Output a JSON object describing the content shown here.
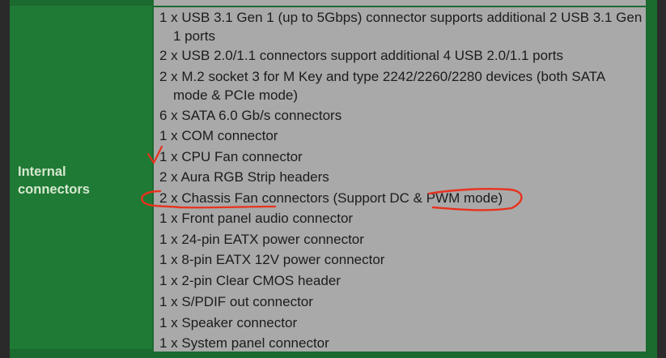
{
  "section_label": [
    "Internal",
    "connectors"
  ],
  "items": [
    [
      "1 x USB 3.1 Gen 1 (up to 5Gbps) connector supports additional 2 USB 3.1 Gen",
      "1 ports"
    ],
    [
      "2 x USB 2.0/1.1 connectors support additional 4 USB 2.0/1.1 ports"
    ],
    [
      "2 x M.2 socket 3 for M Key and type 2242/2260/2280 devices (both SATA",
      "mode & PCIe mode)"
    ],
    [
      "6 x SATA 6.0 Gb/s connectors"
    ],
    [
      "1 x COM connector"
    ],
    [
      "1 x CPU Fan connector"
    ],
    [
      "2 x Aura RGB Strip headers"
    ],
    [
      "2 x Chassis Fan connectors (Support DC & PWM mode)"
    ],
    [
      "1 x Front panel audio connector"
    ],
    [
      "1 x 24-pin EATX power connector"
    ],
    [
      "1 x 8-pin EATX 12V power connector"
    ],
    [
      "1 x 2-pin Clear CMOS header"
    ],
    [
      "1 x S/PDIF out connector"
    ],
    [
      "1 x Speaker connector"
    ],
    [
      "1 x System panel connector"
    ]
  ],
  "annotation_color": "#e8321e"
}
